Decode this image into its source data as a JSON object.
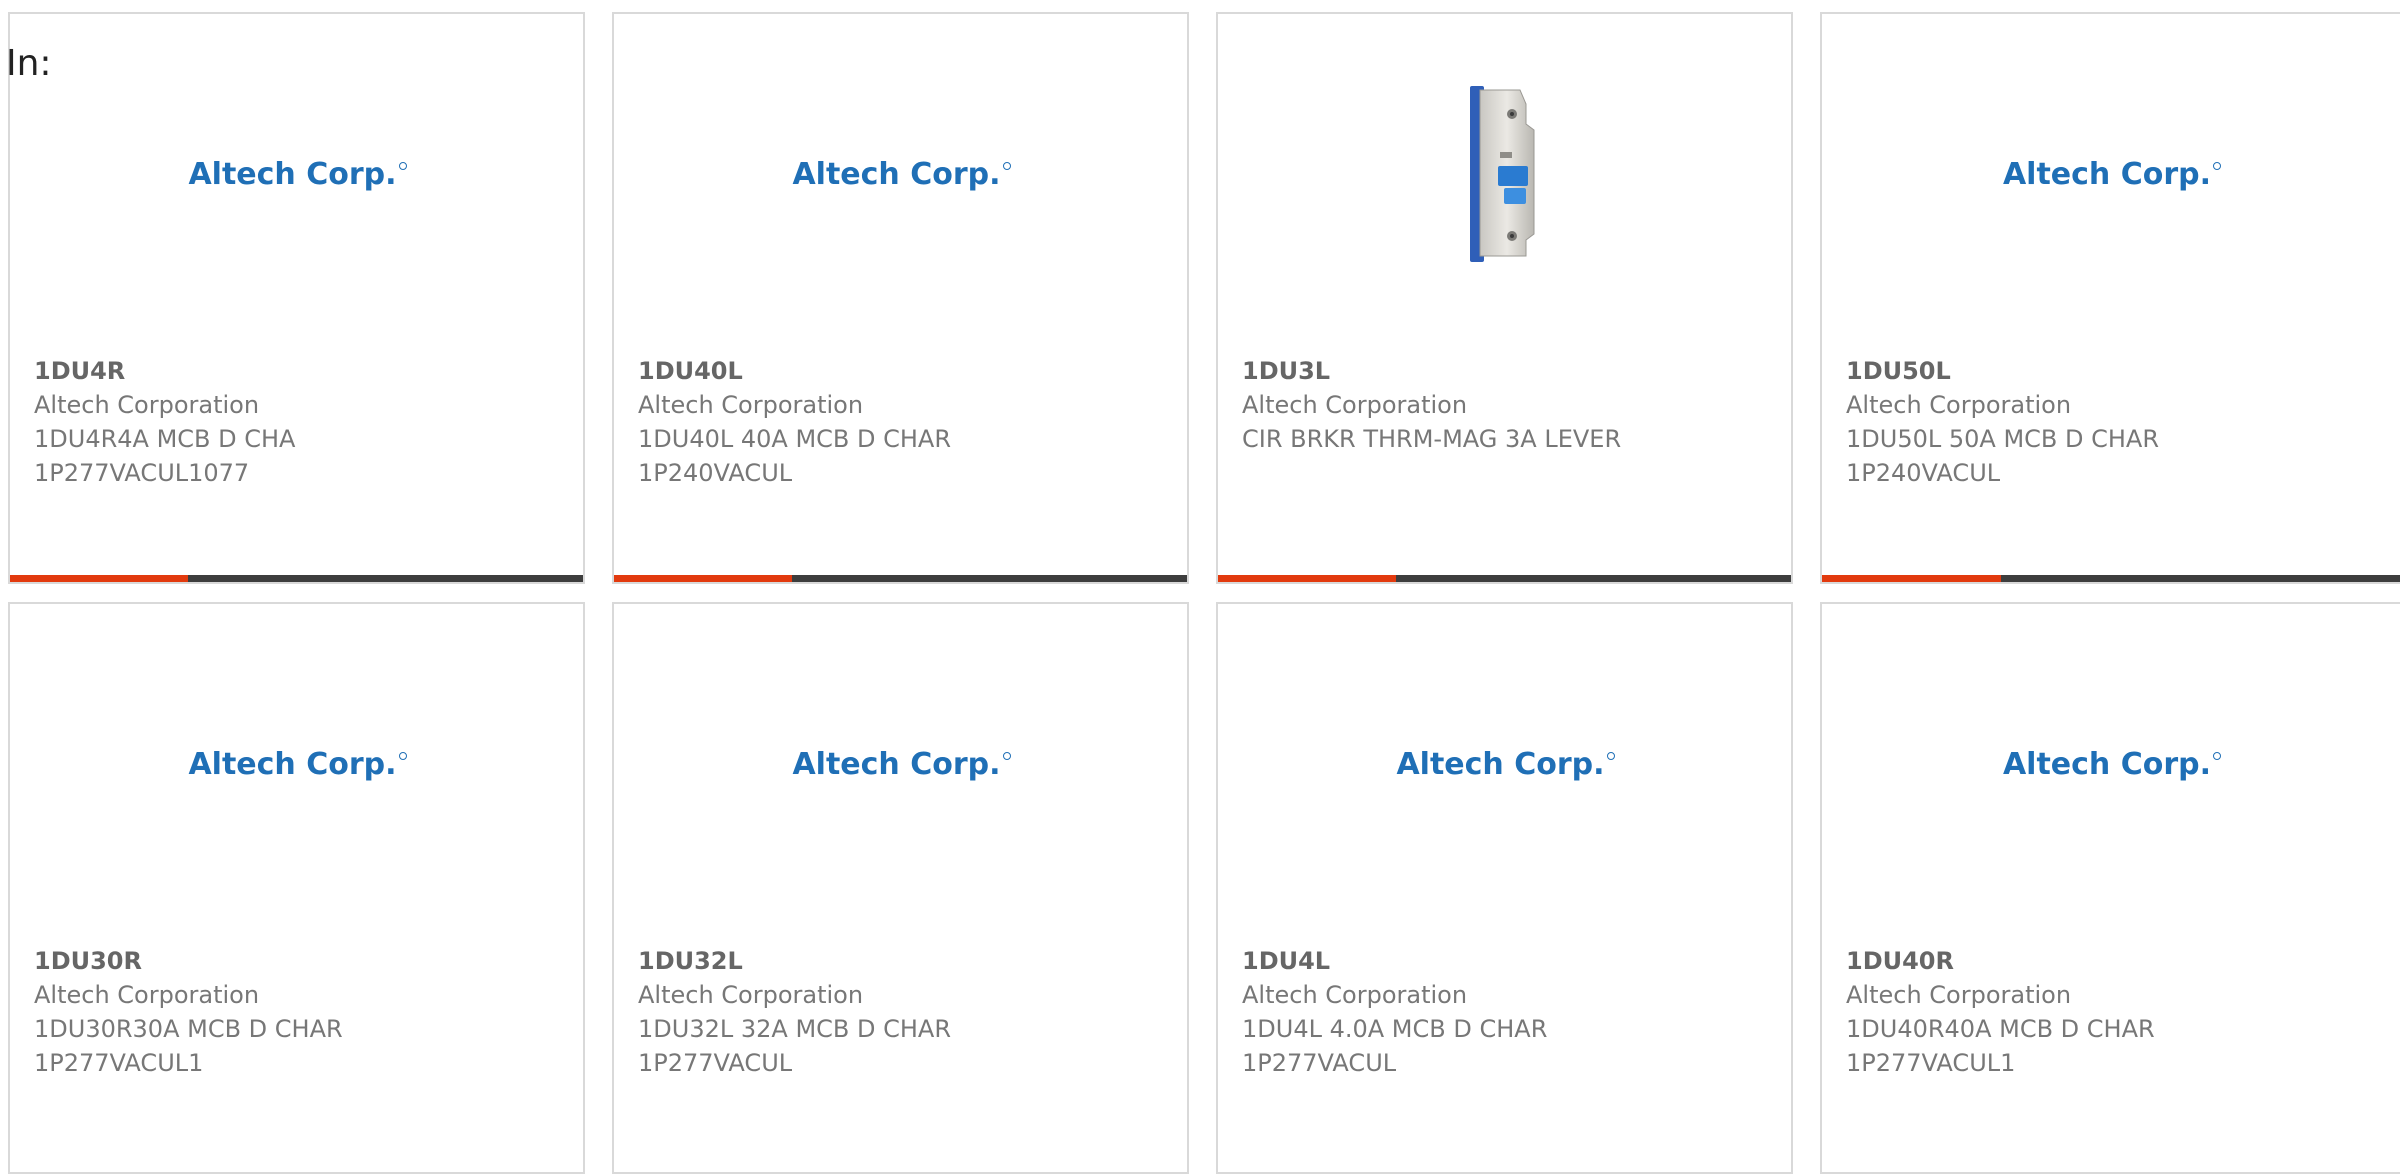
{
  "filter": {
    "in_label": "In:"
  },
  "accent_color": "#e23a0e",
  "bar_color": "#3d3d3d",
  "logo_text": "Altech Corp.",
  "products": [
    {
      "part": "1DU4R",
      "manufacturer": "Altech Corporation",
      "description_line1": "1DU4R4A MCB D CHA",
      "description_line2": "1P277VACUL1077",
      "image": "altech-logo",
      "progress": 0.31
    },
    {
      "part": "1DU40L",
      "manufacturer": "Altech Corporation",
      "description_line1": "1DU40L 40A MCB D CHAR",
      "description_line2": "1P240VACUL",
      "image": "altech-logo",
      "progress": 0.31
    },
    {
      "part": "1DU3L",
      "manufacturer": "Altech Corporation",
      "description_line1": "CIR BRKR THRM-MAG 3A LEVER",
      "description_line2": "",
      "image": "circuit-breaker-photo",
      "progress": 0.31
    },
    {
      "part": "1DU50L",
      "manufacturer": "Altech Corporation",
      "description_line1": "1DU50L 50A MCB D CHAR",
      "description_line2": "1P240VACUL",
      "image": "altech-logo",
      "progress": 0.31
    },
    {
      "part": "1DU30R",
      "manufacturer": "Altech Corporation",
      "description_line1": "1DU30R30A MCB D CHAR",
      "description_line2": "1P277VACUL1",
      "image": "altech-logo",
      "progress": 0.31
    },
    {
      "part": "1DU32L",
      "manufacturer": "Altech Corporation",
      "description_line1": "1DU32L 32A MCB D CHAR",
      "description_line2": "1P277VACUL",
      "image": "altech-logo",
      "progress": 0.31
    },
    {
      "part": "1DU4L",
      "manufacturer": "Altech Corporation",
      "description_line1": "1DU4L 4.0A MCB D CHAR",
      "description_line2": "1P277VACUL",
      "image": "altech-logo",
      "progress": 0.31
    },
    {
      "part": "1DU40R",
      "manufacturer": "Altech Corporation",
      "description_line1": "1DU40R40A MCB D CHAR",
      "description_line2": "1P277VACUL1",
      "image": "altech-logo",
      "progress": 0.31
    }
  ]
}
